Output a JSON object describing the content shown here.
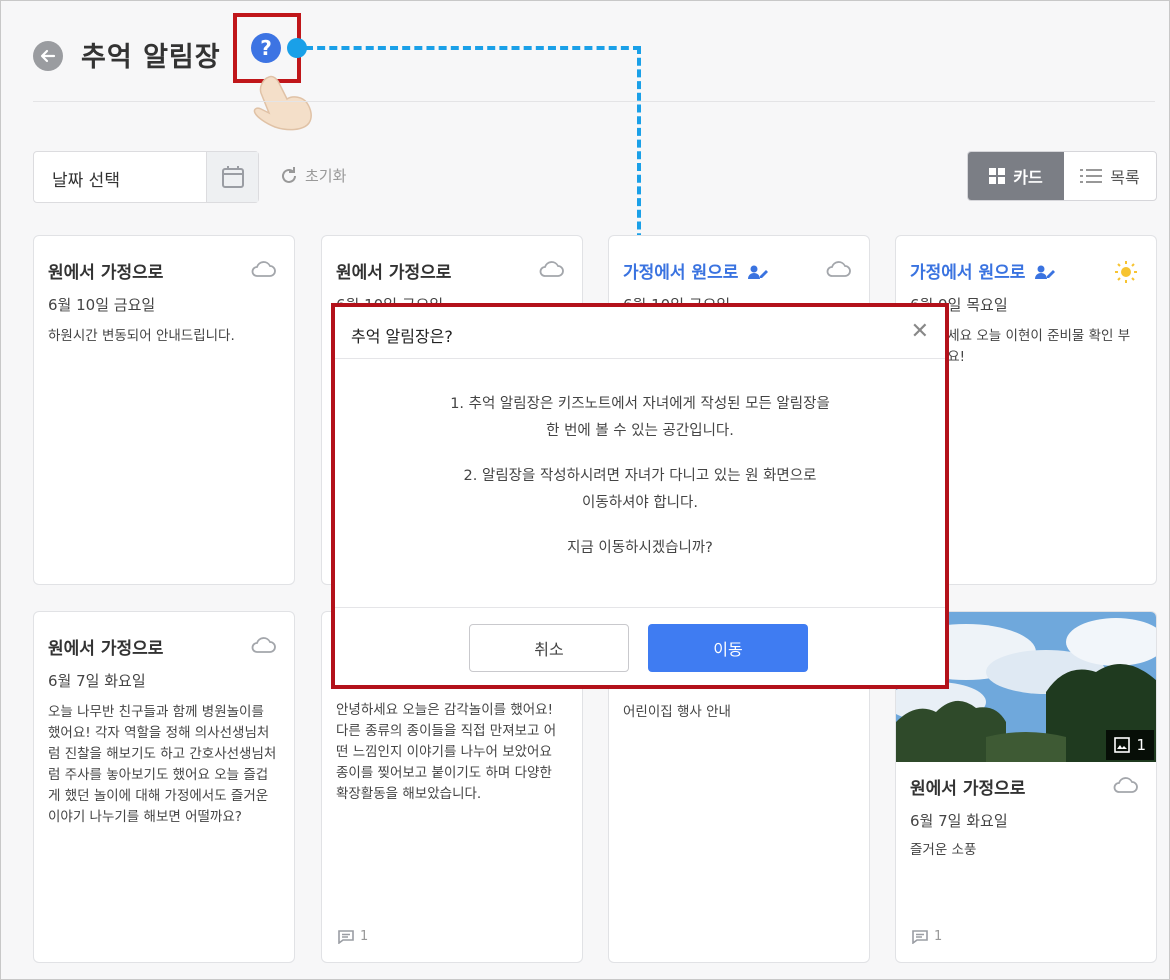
{
  "header": {
    "title": "추억 알림장",
    "help_icon": "question-circle-icon"
  },
  "toolbar": {
    "date_placeholder": "날짜 선택",
    "reset_label": "초기화",
    "view_card_label": "카드",
    "view_list_label": "목록"
  },
  "cards": [
    {
      "title": "원에서 가정으로",
      "date": "6월 10일 금요일",
      "body": "하원시간 변동되어 안내드립니다.",
      "weather": "cloud-icon"
    },
    {
      "title": "원에서 가정으로",
      "date": "6월 10일 금요일",
      "weather": "cloud-icon"
    },
    {
      "title": "가정에서 원으로",
      "date": "6월 10일 금요일",
      "weather": "cloud-icon"
    },
    {
      "title": "가정에서 원으로",
      "date": "6월 9일 목요일",
      "body": "안녕하세요 오늘 이현이 준비물 확인 부탁드려요!",
      "weather": "sun-icon"
    },
    {
      "title": "원에서 가정으로",
      "date": "6월 7일 화요일",
      "body": "오늘 나무반 친구들과 함께 병원놀이를 했어요! 각자 역할을 정해 의사선생님처럼 진찰을 해보기도 하고 간호사선생님처럼 주사를 놓아보기도 했어요 오늘 즐겁게 했던 놀이에 대해 가정에서도 즐거운 이야기 나누기를 해보면 어떨까요?",
      "weather": "cloud-icon"
    },
    {
      "body": "안녕하세요 오늘은 감각놀이를 했어요! 다른 종류의 종이들을 직접 만져보고 어떤 느낌인지 이야기를 나누어 보았어요 종이를 찢어보고 붙이기도 하며 다양한 확장활동을 해보았습니다.",
      "comments": "1"
    },
    {
      "body": "어린이집 행사 안내"
    },
    {
      "title": "원에서 가정으로",
      "date": "6월 7일 화요일",
      "body": "즐거운 소풍",
      "photo_count": "1",
      "comments": "1",
      "weather": "cloud-icon"
    }
  ],
  "modal": {
    "title": "추억 알림장은?",
    "line1": "1. 추억 알림장은 키즈노트에서 자녀에게 작성된 모든 알림장을",
    "line2": "한 번에 볼 수 있는 공간입니다.",
    "line3": "2. 알림장을 작성하시려면 자녀가 다니고 있는 원 화면으로",
    "line4": "이동하셔야 합니다.",
    "line5": "지금 이동하시겠습니까?",
    "cancel_label": "취소",
    "confirm_label": "이동"
  },
  "colors": {
    "accent": "#3f7cf2",
    "annotation_red": "#c0161a",
    "annotation_blue": "#1aa0e8"
  }
}
